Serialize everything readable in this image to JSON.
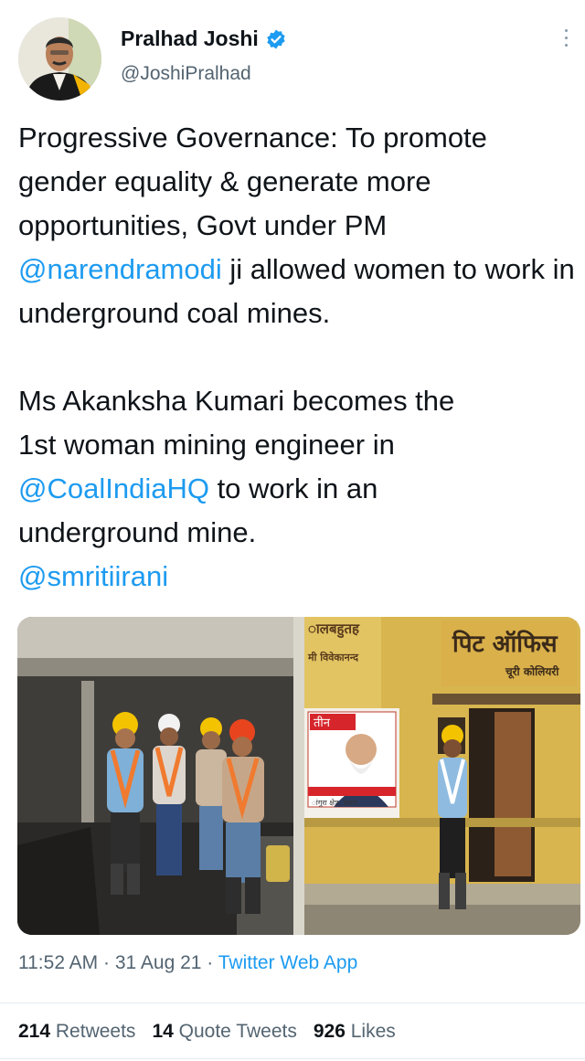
{
  "author": {
    "name": "Pralhad Joshi",
    "handle": "@JoshiPralhad",
    "verified_icon": "verified-badge-icon",
    "avatar_icon": "profile-photo"
  },
  "tweet": {
    "p1_a": "Progressive Governance: To promote gender equality & generate more opportunities, Govt under PM ",
    "p1_mention": "@narendramodi",
    "p1_b": " ji allowed women to work in underground coal mines.",
    "p2_a": "Ms Akanksha Kumari becomes the 1st woman mining engineer in ",
    "p2_mention": "@CoalIndiaHQ",
    "p2_b": " to work in an underground mine.",
    "p3_mention": "@smritiirani"
  },
  "media": {
    "left_photo": "mine-workers-group-photo",
    "right_photo": "woman-engineer-pit-office-photo",
    "sign_main": "पिट ऑफिस",
    "sign_sub": "चूरी कोलियरी",
    "wall_text_1": "ालबहुतह",
    "wall_text_2": "मी विवेकानन्द",
    "poster_top": "तीन",
    "poster_bottom": "ांगुरा क्षेत्र, डकरा"
  },
  "meta": {
    "time": "11:52 AM",
    "sep1": " · ",
    "date": "31 Aug 21",
    "sep2": " · ",
    "app": "Twitter Web App"
  },
  "stats": {
    "retweets_count": "214",
    "retweets_label": "Retweets",
    "quotes_count": "14",
    "quotes_label": "Quote Tweets",
    "likes_count": "926",
    "likes_label": "Likes"
  },
  "colors": {
    "accent": "#1d9bf0",
    "text": "#0f1419",
    "secondary": "#536471"
  }
}
